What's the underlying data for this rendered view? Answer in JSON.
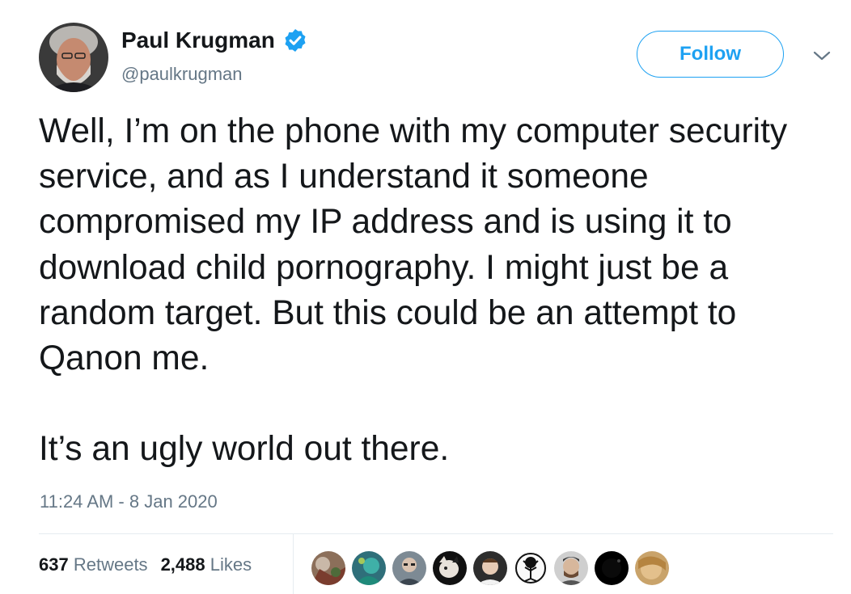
{
  "author": {
    "name": "Paul Krugman",
    "handle": "@paulkrugman",
    "verified": true
  },
  "follow_button": {
    "label": "Follow"
  },
  "tweet": {
    "paragraphs": [
      "Well, I’m on the phone with my computer security service, and as I understand it someone compromised my IP address and is using it to download child pornography. I might just be a random target. But this could be an attempt to Qanon me.",
      "It’s an ugly world out there."
    ],
    "timestamp": "11:24 AM - 8 Jan 2020"
  },
  "stats": {
    "retweets_count": "637",
    "retweets_label": "Retweets",
    "likes_count": "2,488",
    "likes_label": "Likes"
  },
  "colors": {
    "accent": "#1da1f2",
    "text": "#14171a",
    "secondary": "#657786",
    "divider": "#e6ecf0"
  },
  "icons": [
    "verified-badge-icon",
    "chevron-down-icon"
  ]
}
